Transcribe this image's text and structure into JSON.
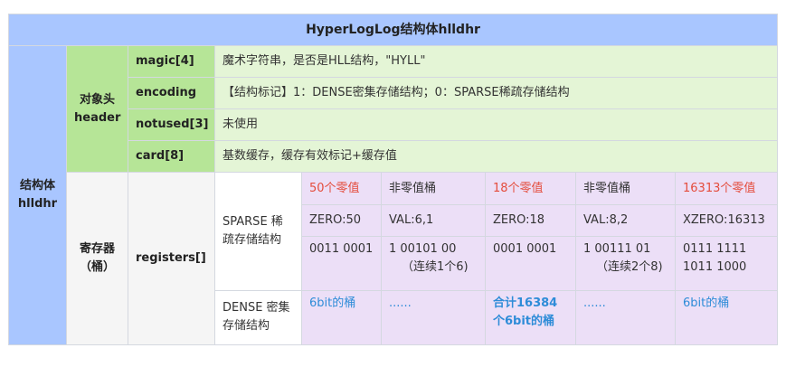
{
  "title": "HyperLogLog结构体hlldhr",
  "struct_label": [
    "结构体",
    "hlldhr"
  ],
  "header_label": [
    "对象头",
    "header"
  ],
  "header_fields": [
    {
      "name": "magic[4]",
      "desc": "魔术字符串，是否是HLL结构，\"HYLL\""
    },
    {
      "name": "encoding",
      "desc": "【结构标记】1：DENSE密集存储结构；0：SPARSE稀疏存储结构"
    },
    {
      "name": "notused[3]",
      "desc": "未使用"
    },
    {
      "name": "card[8]",
      "desc": "基数缓存，缓存有效标记+缓存值"
    }
  ],
  "register_label": [
    "寄存器",
    "（桶）"
  ],
  "registers_field": "registers[]",
  "sparse": {
    "label": [
      "SPARSE 稀",
      "疏存储结构"
    ],
    "row1": [
      "50个零值",
      "非零值桶",
      "18个零值",
      "非零值桶",
      "16313个零值"
    ],
    "row2": [
      "ZERO:50",
      "VAL:6,1",
      "ZERO:18",
      "VAL:8,2",
      "XZERO:16313"
    ],
    "row3": [
      [
        "0011 0001"
      ],
      [
        "1 00101 00",
        "（连续1个6)"
      ],
      [
        "0001 0001"
      ],
      [
        "1 00111 01",
        "（连续2个8)"
      ],
      [
        "0111 1111",
        "1011 1000"
      ]
    ]
  },
  "dense": {
    "label": [
      "DENSE 密集",
      "存储结构"
    ],
    "cells": [
      [
        "6bit的桶"
      ],
      [
        "......"
      ],
      [
        "合计16384",
        "个6bit的桶"
      ],
      [
        "......"
      ],
      [
        "6bit的桶"
      ]
    ]
  },
  "colors": {
    "title_bg": "#a9c6ff",
    "green": "#b6e597",
    "light_green": "#e4f5d6",
    "purple": "#ecdff7",
    "red": "#e44c3c",
    "link_blue": "#2e8cd8"
  }
}
